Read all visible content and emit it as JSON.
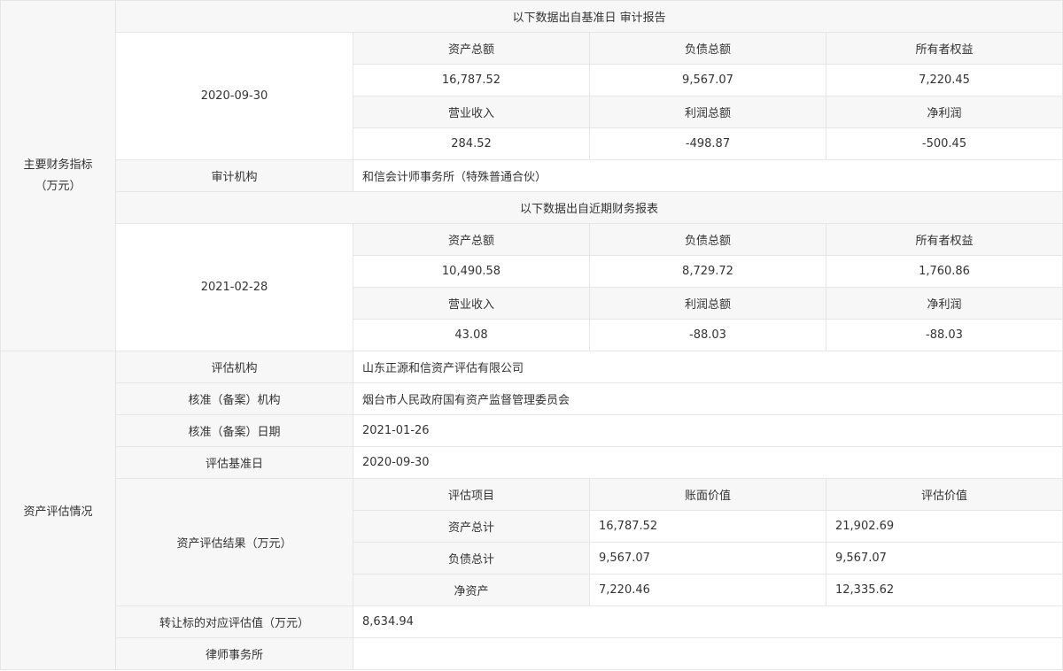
{
  "financial": {
    "category_line1": "主要财务指标",
    "category_line2": "（万元）",
    "audit_block": {
      "header": "以下数据出自基准日 审计报告",
      "date": "2020-09-30",
      "row1_headers": [
        "资产总额",
        "负债总额",
        "所有者权益"
      ],
      "row1_values": [
        "16,787.52",
        "9,567.07",
        "7,220.45"
      ],
      "row2_headers": [
        "营业收入",
        "利润总额",
        "净利润"
      ],
      "row2_values": [
        "284.52",
        "-498.87",
        "-500.45"
      ]
    },
    "audit_org_label": "审计机构",
    "audit_org_value": "和信会计师事务所（特殊普通合伙）",
    "recent_block": {
      "header": "以下数据出自近期财务报表",
      "date": "2021-02-28",
      "row1_headers": [
        "资产总额",
        "负债总额",
        "所有者权益"
      ],
      "row1_values": [
        "10,490.58",
        "8,729.72",
        "1,760.86"
      ],
      "row2_headers": [
        "营业收入",
        "利润总额",
        "净利润"
      ],
      "row2_values": [
        "43.08",
        "-88.03",
        "-88.03"
      ]
    }
  },
  "valuation": {
    "category": "资产评估情况",
    "rows": [
      {
        "label": "评估机构",
        "value": "山东正源和信资产评估有限公司"
      },
      {
        "label": "核准（备案）机构",
        "value": "烟台市人民政府国有资产监督管理委员会"
      },
      {
        "label": "核准（备案）日期",
        "value": "2021-01-26"
      },
      {
        "label": "评估基准日",
        "value": "2020-09-30"
      }
    ],
    "result_label": "资产评估结果（万元）",
    "result_headers": [
      "评估项目",
      "账面价值",
      "评估价值"
    ],
    "result_rows": [
      [
        "资产总计",
        "16,787.52",
        "21,902.69"
      ],
      [
        "负债总计",
        "9,567.07",
        "9,567.07"
      ],
      [
        "净资产",
        "7,220.46",
        "12,335.62"
      ]
    ],
    "transfer_label": "转让标的对应评估值（万元）",
    "transfer_value": "8,634.94",
    "law_firm_label": "律师事务所",
    "law_firm_value": ""
  }
}
